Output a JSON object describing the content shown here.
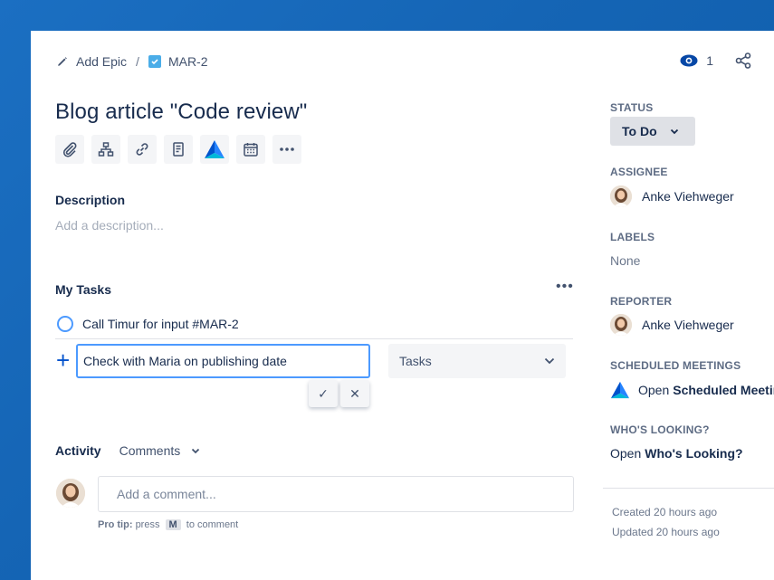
{
  "breadcrumb": {
    "epic_label": "Add Epic",
    "separator": "/",
    "issue_key": "MAR-2"
  },
  "header": {
    "watch_count": "1"
  },
  "issue": {
    "title": "Blog article \"Code review\""
  },
  "description": {
    "label": "Description",
    "placeholder": "Add a description..."
  },
  "tasks": {
    "label": "My Tasks",
    "more": "•••",
    "items": [
      {
        "label": "Call Timur for input #MAR-2"
      }
    ],
    "new_task_value": "Check with Maria on publishing date",
    "select_value": "Tasks",
    "plus": "+",
    "confirm": "✓",
    "cancel": "✕"
  },
  "activity": {
    "label": "Activity",
    "filter": "Comments",
    "comment_placeholder": "Add a comment...",
    "protip_bold": "Pro tip:",
    "protip_pre": "press",
    "protip_key": "M",
    "protip_post": "to comment"
  },
  "sidebar": {
    "status_label": "STATUS",
    "status_value": "To Do",
    "assignee_label": "ASSIGNEE",
    "assignee_name": "Anke Viehweger",
    "labels_label": "LABELS",
    "labels_value": "None",
    "reporter_label": "REPORTER",
    "reporter_name": "Anke Viehweger",
    "meetings_label": "SCHEDULED MEETINGS",
    "meetings_open": "Open",
    "meetings_link": "Scheduled Meetings",
    "looking_label": "WHO'S LOOKING?",
    "looking_open": "Open",
    "looking_link": "Who's Looking?",
    "created": "Created 20 hours ago",
    "updated": "Updated 20 hours ago"
  },
  "colors": {
    "accent": "#0052cc",
    "focus": "#4c9aff",
    "background": "#1565b5"
  }
}
